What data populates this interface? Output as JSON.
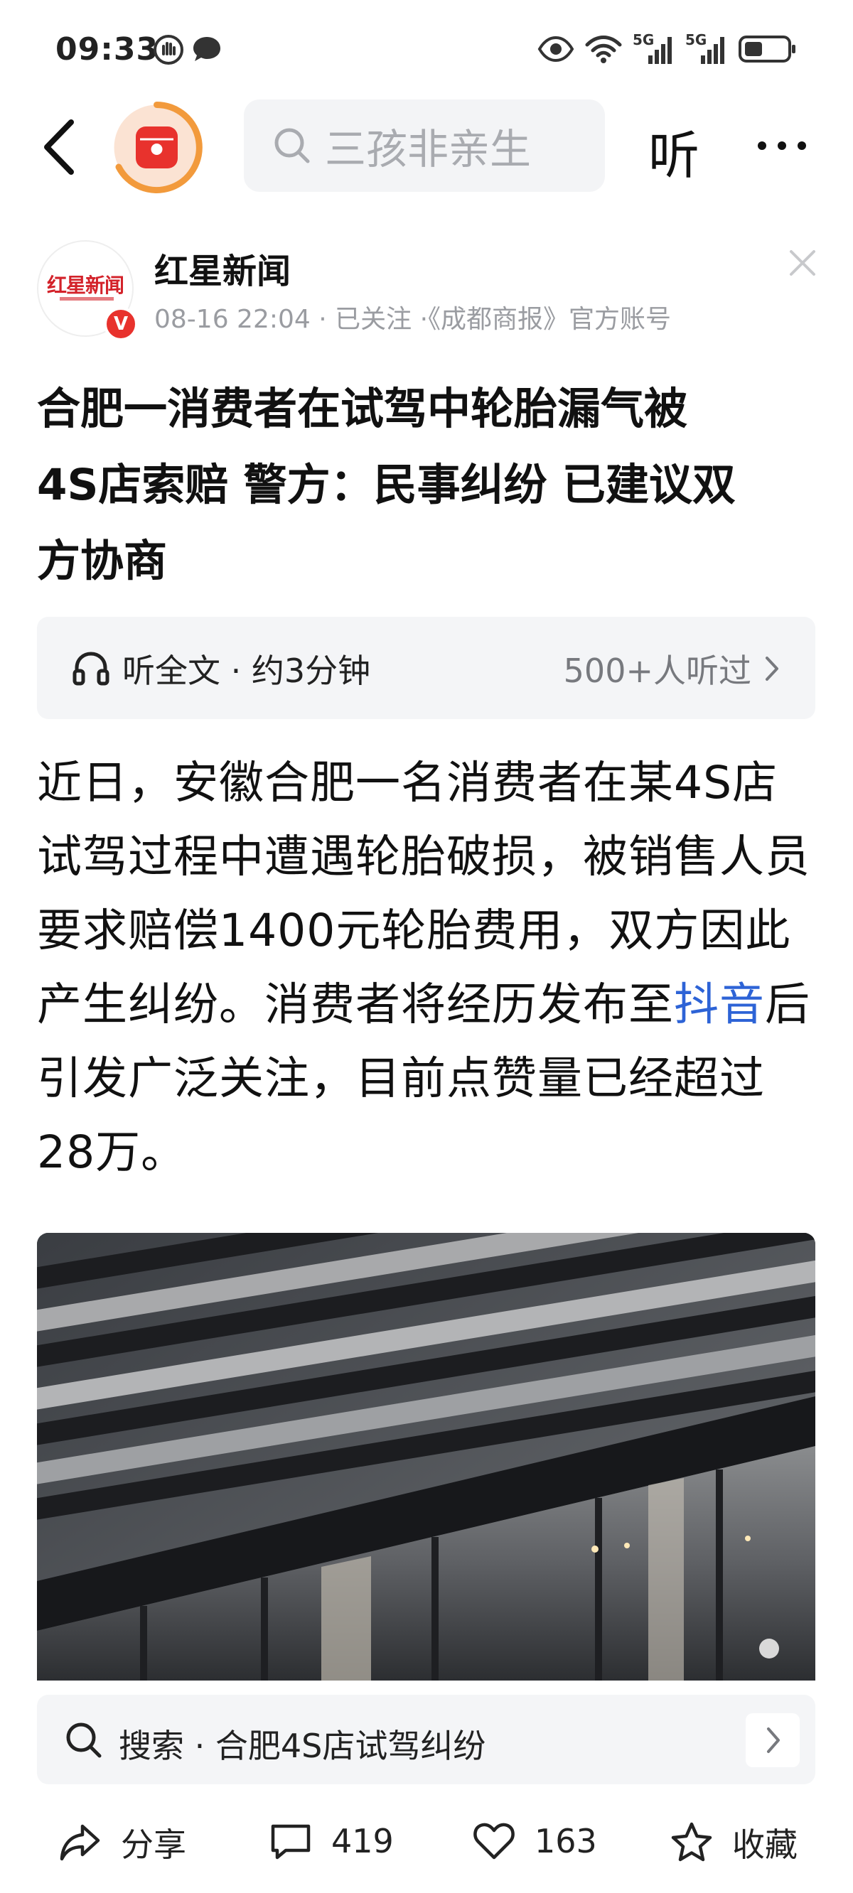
{
  "status_bar": {
    "time": "09:33",
    "signal1_label": "5G",
    "signal2_label": "5G"
  },
  "nav": {
    "search_placeholder": "三孩非亲生",
    "listen_label": "听"
  },
  "author": {
    "logo_text": "红星新闻",
    "verified_badge": "V",
    "name": "红星新闻",
    "meta": "08-16 22:04 · 已关注 ·《成都商报》官方账号"
  },
  "article": {
    "title_line1": "合肥一消费者在试驾中轮胎漏气被",
    "title_line2": "4S店索赔 警方：民事纠纷 已建议双",
    "title_line3": "方协商",
    "listen_bar": {
      "label": "听全文 · 约3分钟",
      "count": "500+人听过"
    },
    "body_before_link": "近日，安徽合肥一名消费者在某4S店试驾过程中遭遇轮胎破损，被销售人员要求赔偿1400元轮胎费用，双方因此产生纠纷。消费者将经历发布至",
    "body_link": "抖音",
    "body_after_link": "后引发广泛关注，目前点赞量已经超过28万。"
  },
  "search_suggest": {
    "label": "搜索 · 合肥4S店试驾纠纷"
  },
  "bottom_bar": {
    "share_label": "分享",
    "comments_count": "419",
    "likes_count": "163",
    "favorite_label": "收藏"
  },
  "colors": {
    "accent_red": "#e8322d",
    "link_blue": "#2d63d6",
    "logo_ring_orange": "#f29a3c"
  }
}
